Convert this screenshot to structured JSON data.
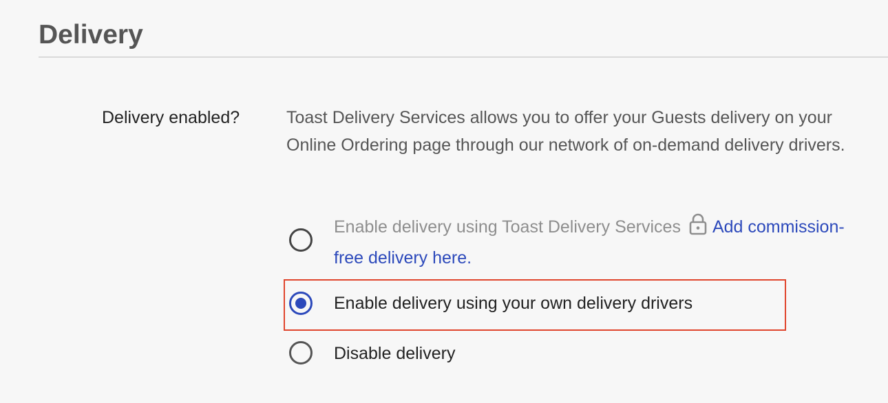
{
  "section": {
    "title": "Delivery"
  },
  "field": {
    "label": "Delivery enabled?",
    "description": "Toast Delivery Services allows you to offer your Guests delivery on your Online Ordering page through our network of on-demand delivery drivers."
  },
  "options": [
    {
      "label": "Enable delivery using Toast Delivery Services",
      "icon": "lock-icon",
      "link_text": "Add commission-free delivery here.",
      "state": "disabled",
      "selected": false
    },
    {
      "label": "Enable delivery using your own delivery drivers",
      "state": "enabled",
      "selected": true
    },
    {
      "label": "Disable delivery",
      "state": "enabled",
      "selected": false
    }
  ],
  "colors": {
    "accent": "#2c49bb",
    "highlight": "#e0452d",
    "disabled_text": "#8e8e8e",
    "background": "#f7f7f7"
  }
}
